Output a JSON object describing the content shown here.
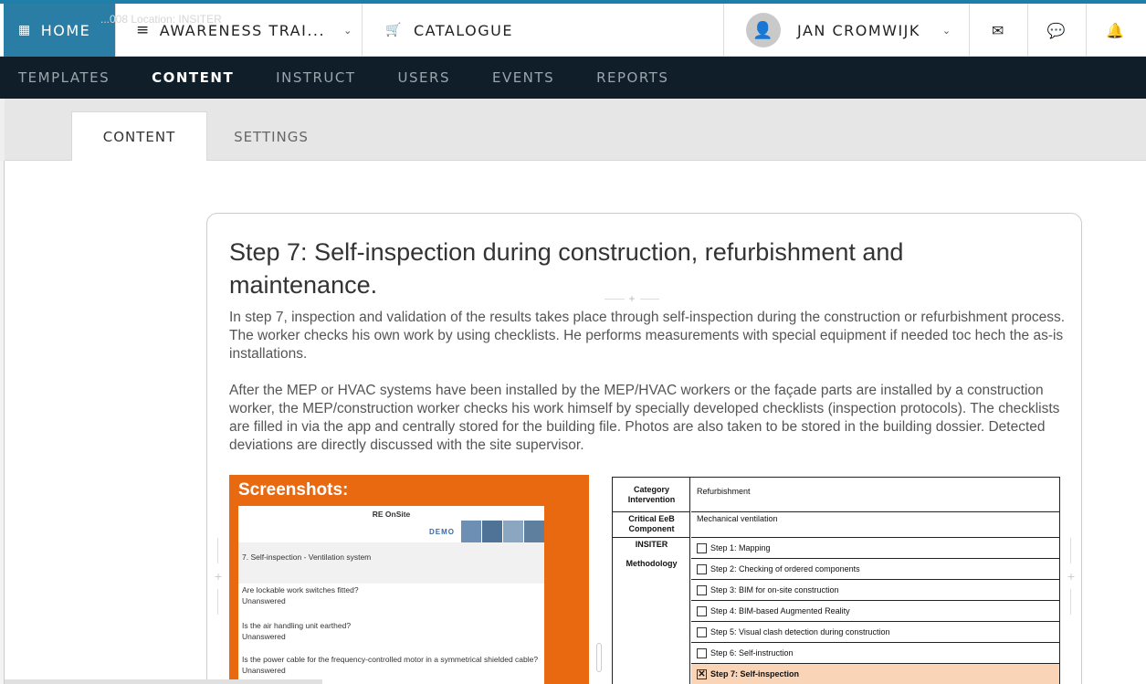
{
  "topbar": {
    "home": {
      "icon": "grid-icon",
      "label": "HOME"
    },
    "faint_text": "...008  Location: INSITER",
    "course": {
      "icon": "menu-icon",
      "label": "AWARENESS TRAI...",
      "chevron": "chevron-down-icon"
    },
    "catalogue": {
      "icon": "cart-icon",
      "label": "CATALOGUE"
    },
    "user": {
      "icon": "add-user-icon",
      "name": "JAN CROMWIJK",
      "chevron": "chevron-down-icon"
    },
    "icons": [
      "mail-icon",
      "chat-icon",
      "bell-icon"
    ],
    "accent": "#2a7ea6"
  },
  "nav": {
    "items": [
      "TEMPLATES",
      "CONTENT",
      "INSTRUCT",
      "USERS",
      "EVENTS",
      "REPORTS"
    ],
    "active": "CONTENT",
    "bg": "#0f1e28"
  },
  "subtabs": [
    "CONTENT",
    "SETTINGS"
  ],
  "content": {
    "title": "Step 7: Self-inspection during construction, refurbishment and maintenance.",
    "paragraph1": "In step 7, inspection and validation of the results takes place through self-inspection during the construction or refurbishment process. The worker checks his own work by using checklists. He performs measurements with special equipment if needed toc hech the as-is installations.",
    "paragraph2": "After the MEP or HVAC systems have been installed by the MEP/HVAC workers or the façade parts are installed by a construction worker, the MEP/construction worker checks his work himself by specially developed checklists (inspection protocols). The checklists are filled in via the app and centrally stored for the building file. Photos are also taken to be stored in the building dossier. Detected deviations are directly discussed with the site supervisor."
  },
  "screenshot_panel": {
    "title": "Screenshots:",
    "app_name": "RE OnSite",
    "logo_text": "DEMO",
    "header": "7. Self-inspection - Ventilation system",
    "questions": [
      {
        "q": "Are lockable work switches fitted?",
        "a": "Unanswered"
      },
      {
        "q": "Is the air handling unit earthed?",
        "a": "Unanswered"
      },
      {
        "q": "Is the power cable for the frequency-controlled motor in a symmetrical shielded cable?",
        "a": "Unanswered"
      }
    ],
    "color": "#e8690f"
  },
  "table": {
    "category_label": "Category Intervention",
    "category_value": "Refurbishment",
    "component_label": "Critical EeB Component",
    "component_value": "Mechanical ventilation",
    "insiter_label": "INSITER",
    "methodology_label": "Methodology",
    "steps": [
      {
        "label": "Step 1: Mapping",
        "checked": false
      },
      {
        "label": "Step 2: Checking of ordered components",
        "checked": false
      },
      {
        "label": "Step 3: BIM for on-site construction",
        "checked": false
      },
      {
        "label": "Step 4: BIM-based Augmented Reality",
        "checked": false
      },
      {
        "label": "Step 5: Visual clash detection during construction",
        "checked": false
      },
      {
        "label": "Step 6: Self-instruction",
        "checked": false
      },
      {
        "label": "Step 7: Self-inspection",
        "checked": true
      }
    ],
    "highlight": "#fad4b6"
  }
}
